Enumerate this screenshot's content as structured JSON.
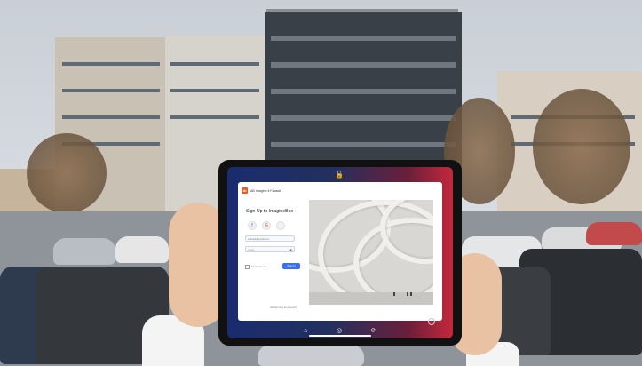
{
  "app": {
    "brand_initials": "Ai",
    "brand_name": "AB Imagine it Facade",
    "title": "Sign Up to ImagineBox",
    "social": [
      {
        "icon": "facebook-icon",
        "glyph": "f",
        "color": "#1877f2"
      },
      {
        "icon": "google-icon",
        "glyph": "G",
        "color": "#ea4335"
      },
      {
        "icon": "apple-icon",
        "glyph": "",
        "color": "#111111"
      }
    ],
    "fields": {
      "email_placeholder": "example@email.com",
      "password_placeholder": "••••••••"
    },
    "remember_label": "Remember me",
    "signin_label": "Sign In",
    "switch_text": "Already have an account?"
  },
  "dock": [
    {
      "icon": "home-icon",
      "glyph": "⌂"
    },
    {
      "icon": "compass-icon",
      "glyph": "◎"
    },
    {
      "icon": "sync-icon",
      "glyph": "⟳"
    }
  ],
  "status": {
    "lock_icon": "unlock-icon"
  },
  "colors": {
    "accent": "#3b6ff2",
    "brand": "#e65a24",
    "screen_gradient": [
      "#1a2c6e",
      "#c4283c"
    ]
  }
}
